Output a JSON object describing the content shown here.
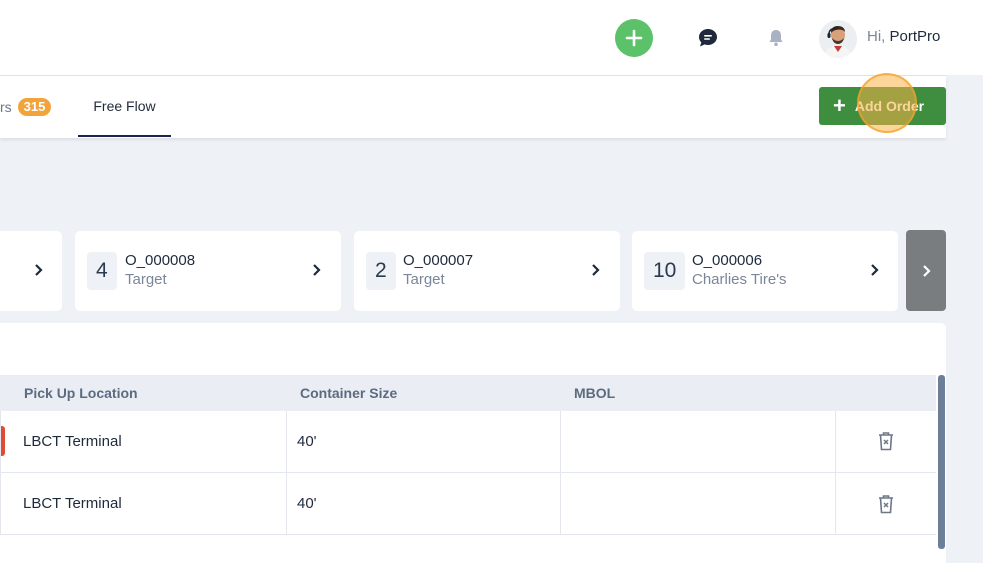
{
  "header": {
    "greeting_prefix": "Hi,",
    "user_name": "PortPro"
  },
  "tabs": {
    "partial_label": "rs",
    "partial_badge": "315",
    "active_label": "Free Flow"
  },
  "actions": {
    "add_order_label": "Add Order"
  },
  "cards": [
    {
      "count": "4",
      "order_id": "O_000008",
      "customer": "Target"
    },
    {
      "count": "2",
      "order_id": "O_000007",
      "customer": "Target"
    },
    {
      "count": "10",
      "order_id": "O_000006",
      "customer": "Charlies Tire's"
    }
  ],
  "table": {
    "columns": [
      "Pick Up Location",
      "Container Size",
      "MBOL"
    ],
    "rows": [
      {
        "pickup": "LBCT Terminal",
        "size": "40'",
        "mbol": ""
      },
      {
        "pickup": "LBCT Terminal",
        "size": "40'",
        "mbol": ""
      }
    ]
  },
  "colors": {
    "accent_green": "#3f8d3f",
    "fab_green": "#5cc26a",
    "badge_orange": "#f2a33a",
    "active_tab_underline": "#1a2354",
    "status_red": "#e14a36"
  },
  "icons": [
    "plus-icon",
    "chat-icon",
    "bell-icon",
    "avatar",
    "chevron-right-icon",
    "trash-icon"
  ]
}
